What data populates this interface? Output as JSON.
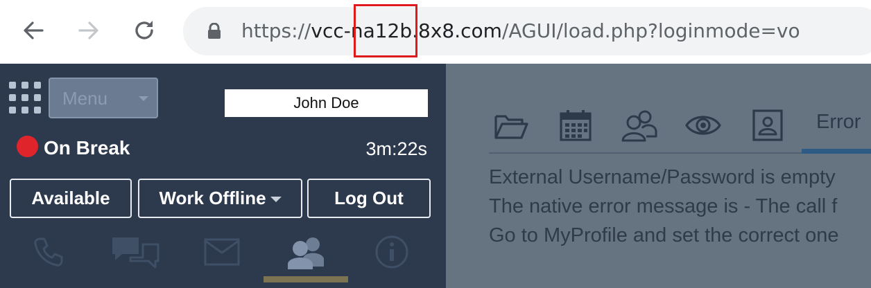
{
  "browser": {
    "url_scheme": "https://",
    "url_host": "vcc-na12b.8x8.com",
    "url_path": "/AGUI/load.php?loginmode=vo"
  },
  "agent_panel": {
    "menu_label": "Menu",
    "user_name": "John Doe",
    "status_label": "On Break",
    "status_color": "#e0242c",
    "timer": "3m:22s",
    "buttons": {
      "available": "Available",
      "work_offline": "Work Offline",
      "log_out": "Log Out"
    },
    "channel_tabs": [
      "phone-icon",
      "chat-icon",
      "email-icon",
      "contacts-icon",
      "info-icon"
    ],
    "active_tab": "contacts-icon"
  },
  "content": {
    "toolbar_icons": [
      "folder-icon",
      "calendar-icon",
      "users-icon",
      "eye-icon",
      "profile-card-icon"
    ],
    "active_tab_label": "Error",
    "messages": [
      "External Username/Password is empty",
      "The native error message is - The call f",
      "Go to MyProfile and set the correct one"
    ]
  }
}
